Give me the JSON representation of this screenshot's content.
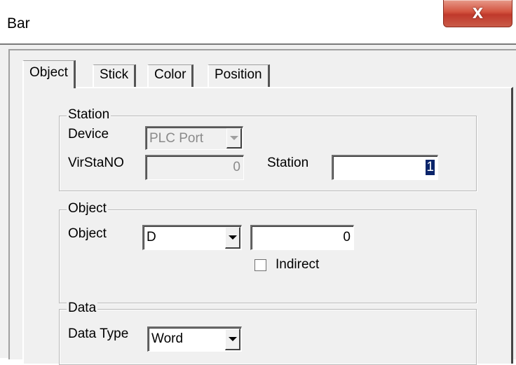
{
  "window": {
    "title": "Bar",
    "close_glyph": "X"
  },
  "tabs": [
    {
      "label": "Object",
      "active": true
    },
    {
      "label": "Stick",
      "active": false
    },
    {
      "label": "Color",
      "active": false
    },
    {
      "label": "Position",
      "active": false
    }
  ],
  "station_group": {
    "title": "Station",
    "device_label": "Device",
    "device_value": "PLC Port",
    "virstano_label": "VirStaNO",
    "virstano_value": "0",
    "station_label": "Station",
    "station_value": "1"
  },
  "object_group": {
    "title": "Object",
    "object_label": "Object",
    "object_type": "D",
    "object_address": "0",
    "indirect_label": "Indirect",
    "indirect_checked": false
  },
  "data_group": {
    "title": "Data",
    "data_type_label": "Data Type",
    "data_type_value": "Word"
  }
}
